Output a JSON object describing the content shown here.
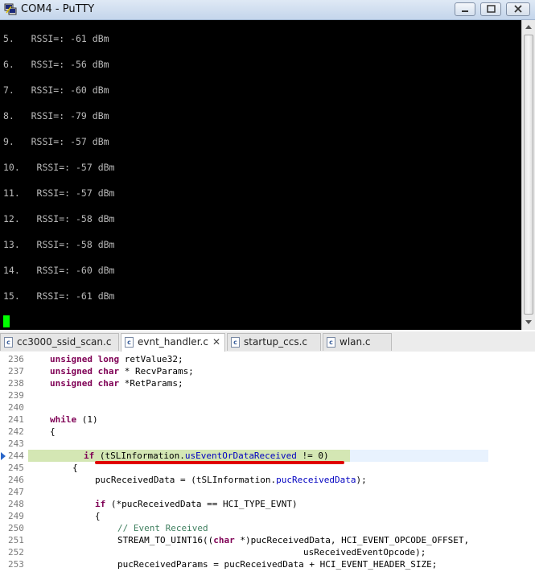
{
  "window": {
    "title": "COM4 - PuTTY"
  },
  "terminal_lines": [
    "5.   RSSI=: -61 dBm",
    "6.   RSSI=: -56 dBm",
    "7.   RSSI=: -60 dBm",
    "8.   RSSI=: -79 dBm",
    "9.   RSSI=: -57 dBm",
    "10.   RSSI=: -57 dBm",
    "11.   RSSI=: -57 dBm",
    "12.   RSSI=: -58 dBm",
    "13.   RSSI=: -58 dBm",
    "14.   RSSI=: -60 dBm",
    "15.   RSSI=: -61 dBm"
  ],
  "tabs": [
    {
      "label": "cc3000_ssid_scan.c",
      "active": false
    },
    {
      "label": "evnt_handler.c",
      "active": true
    },
    {
      "label": "startup_ccs.c",
      "active": false
    },
    {
      "label": "wlan.c",
      "active": false
    }
  ],
  "tab_close_glyph": "✕",
  "code": {
    "line_numbers": [
      "236",
      "237",
      "238",
      "239",
      "240",
      "241",
      "242",
      "243",
      "244",
      "245",
      "246",
      "247",
      "248",
      "249",
      "250",
      "251",
      "252",
      "253"
    ],
    "l236_kw": "unsigned long",
    "l236_rest": " retValue32;",
    "l237_kw": "unsigned char",
    "l237_rest": " * RecvParams;",
    "l238_kw": "unsigned char",
    "l238_rest": " *RetParams;",
    "l241_kw": "while",
    "l241_rest": " (1)",
    "l242": "{",
    "l244_kw": "if",
    "l244_a": " (tSLInformation.",
    "l244_field": "usEventOrDataReceived",
    "l244_b": " != 0)",
    "l245": "{",
    "l246_a": "pucReceivedData = (tSLInformation.",
    "l246_field": "pucReceivedData",
    "l246_b": ");",
    "l248_kw": "if",
    "l248_rest": " (*pucReceivedData == HCI_TYPE_EVNT)",
    "l249": "{",
    "l250_cmt": "// Event Received",
    "l251_a": "STREAM_TO_UINT16((",
    "l251_kw": "char",
    "l251_b": " *)pucReceivedData, HCI_EVENT_OPCODE_OFFSET,",
    "l252": "usReceivedEventOpcode);",
    "l253": "pucReceivedParams = pucReceivedData + HCI_EVENT_HEADER_SIZE;"
  }
}
